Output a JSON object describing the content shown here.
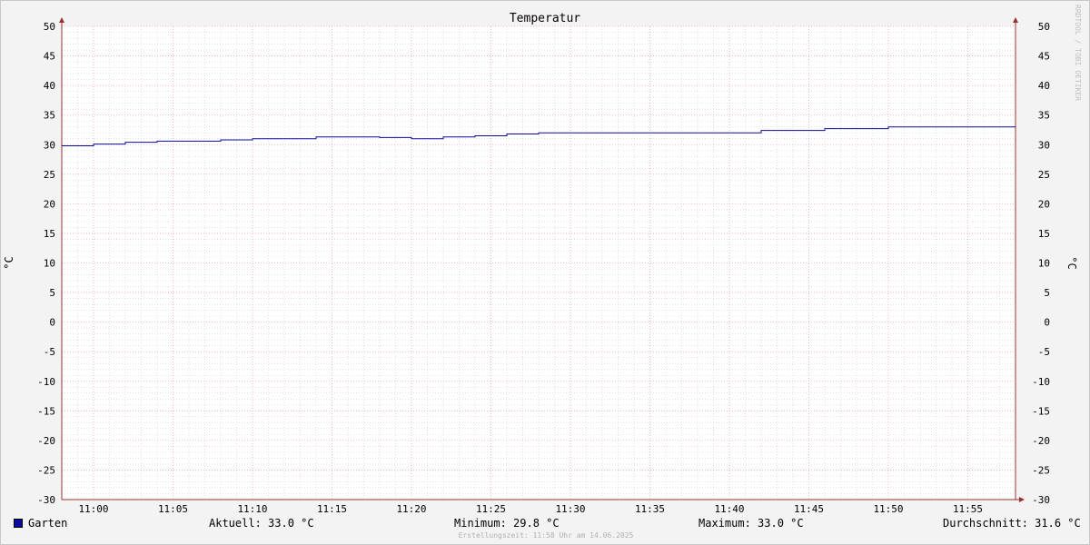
{
  "chart_data": {
    "type": "line",
    "title": "Temperatur",
    "ylabel": "°C",
    "ylabel_right": "°C",
    "ylim": [
      -30,
      50
    ],
    "yticks": [
      50,
      45,
      40,
      35,
      30,
      25,
      20,
      15,
      10,
      5,
      0,
      -5,
      -10,
      -15,
      -20,
      -25,
      -30
    ],
    "xrange_minutes": [
      -2,
      58
    ],
    "xticks": [
      {
        "minute": 0,
        "label": "11:00"
      },
      {
        "minute": 5,
        "label": "11:05"
      },
      {
        "minute": 10,
        "label": "11:10"
      },
      {
        "minute": 15,
        "label": "11:15"
      },
      {
        "minute": 20,
        "label": "11:20"
      },
      {
        "minute": 25,
        "label": "11:25"
      },
      {
        "minute": 30,
        "label": "11:30"
      },
      {
        "minute": 35,
        "label": "11:35"
      },
      {
        "minute": 40,
        "label": "11:40"
      },
      {
        "minute": 45,
        "label": "11:45"
      },
      {
        "minute": 50,
        "label": "11:50"
      },
      {
        "minute": 55,
        "label": "11:55"
      }
    ],
    "grid": true,
    "series": [
      {
        "name": "Garten",
        "color": "#0b0b9c",
        "step": true,
        "x_minutes": [
          -2,
          0,
          2,
          4,
          8,
          10,
          14,
          18,
          20,
          22,
          24,
          26,
          28,
          32,
          36,
          40,
          42,
          46,
          50,
          58
        ],
        "values": [
          29.8,
          30.1,
          30.4,
          30.6,
          30.8,
          31.0,
          31.3,
          31.2,
          31.0,
          31.3,
          31.5,
          31.8,
          32.0,
          32.0,
          32.0,
          32.0,
          32.4,
          32.7,
          33.0,
          33.0
        ]
      }
    ]
  },
  "legend": {
    "series_name": "Garten",
    "current": "Aktuell: 33.0 °C",
    "minimum": "Minimum: 29.8 °C",
    "maximum": "Maximum: 33.0 °C",
    "average": "Durchschnitt: 31.6 °C"
  },
  "footer": "Erstellungszeit: 11:58 Uhr am 14.06.2025",
  "watermark": "RRDTOOL / TOBI OETIKER",
  "colors": {
    "grid_major": "#e3a9b6",
    "grid_minor": "#cfcfcf",
    "axis": "#9a3030",
    "series": "#0b0b9c"
  }
}
